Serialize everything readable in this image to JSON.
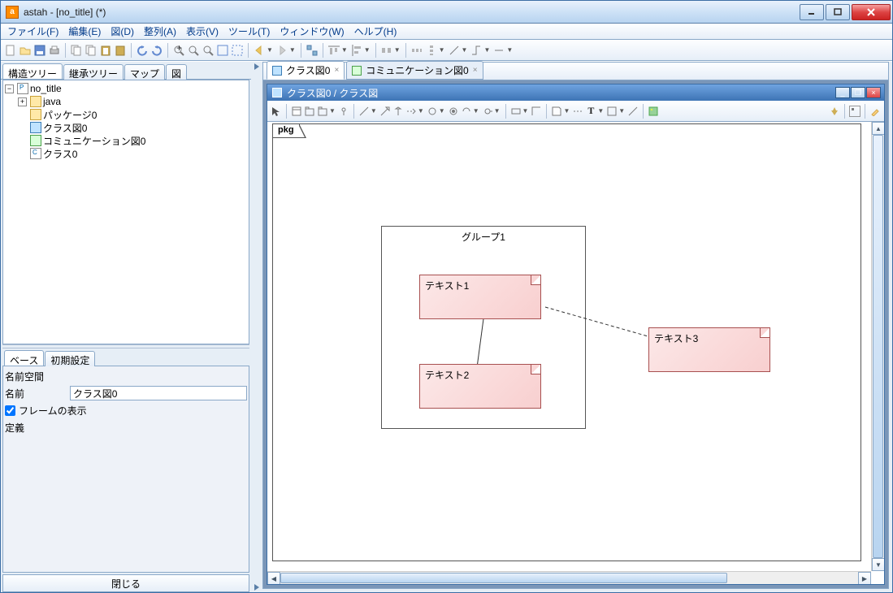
{
  "window": {
    "title": "astah - [no_title] (*)"
  },
  "menu": {
    "file": "ファイル(F)",
    "edit": "編集(E)",
    "diagram": "図(D)",
    "align": "整列(A)",
    "view": "表示(V)",
    "tool": "ツール(T)",
    "window": "ウィンドウ(W)",
    "help": "ヘルプ(H)"
  },
  "leftTabs": {
    "structure": "構造ツリー",
    "inheritance": "継承ツリー",
    "map": "マップ",
    "diagram": "図"
  },
  "tree": {
    "root": "no_title",
    "java": "java",
    "package0": "パッケージ0",
    "class_diag0": "クラス図0",
    "comm_diag0": "コミュニケーション図0",
    "class0": "クラス0"
  },
  "propTabs": {
    "base": "ベース",
    "init": "初期設定"
  },
  "props": {
    "namespace_label": "名前空間",
    "name_label": "名前",
    "name_value": "クラス図0",
    "frame_label": "フレームの表示",
    "def_label": "定義"
  },
  "close_btn": "閉じる",
  "editorTabs": {
    "tab1": "クラス図0",
    "tab2": "コミュニケーション図0"
  },
  "internal": {
    "title": "クラス図0 / クラス図"
  },
  "diagram": {
    "frame_label": "pkg",
    "group1": "グループ1",
    "text1": "テキスト1",
    "text2": "テキスト2",
    "text3": "テキスト3"
  }
}
